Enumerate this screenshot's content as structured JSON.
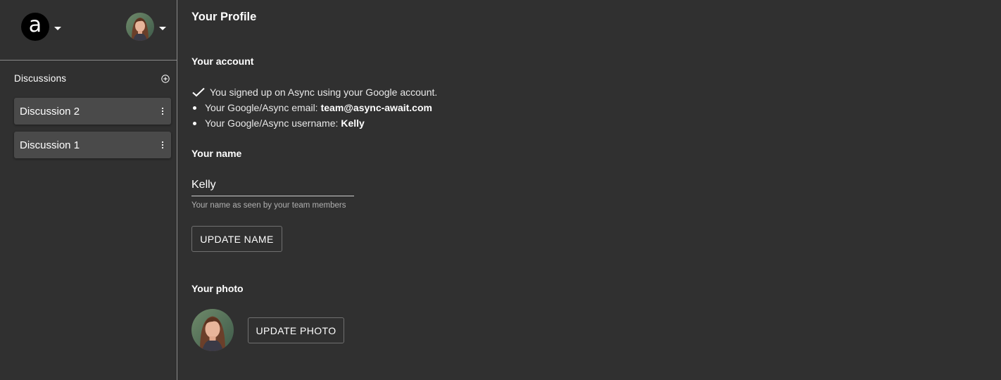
{
  "app": {
    "logo_letter": "a"
  },
  "sidebar": {
    "discussions_title": "Discussions",
    "items": [
      {
        "label": "Discussion 2"
      },
      {
        "label": "Discussion 1"
      }
    ]
  },
  "profile": {
    "page_title": "Your Profile",
    "account": {
      "title": "Your account",
      "signup_text": "You signed up on Async using your Google account.",
      "email_label": "Your Google/Async email:",
      "email_value": "team@async-await.com",
      "username_label": "Your Google/Async username:",
      "username_value": "Kelly"
    },
    "name": {
      "title": "Your name",
      "value": "Kelly",
      "helper": "Your name as seen by your team members",
      "button_label": "UPDATE NAME"
    },
    "photo": {
      "title": "Your photo",
      "button_label": "UPDATE PHOTO"
    }
  },
  "colors": {
    "background": "#303030",
    "item_background": "#4a4a4a",
    "divider": "#8a8a8a"
  }
}
